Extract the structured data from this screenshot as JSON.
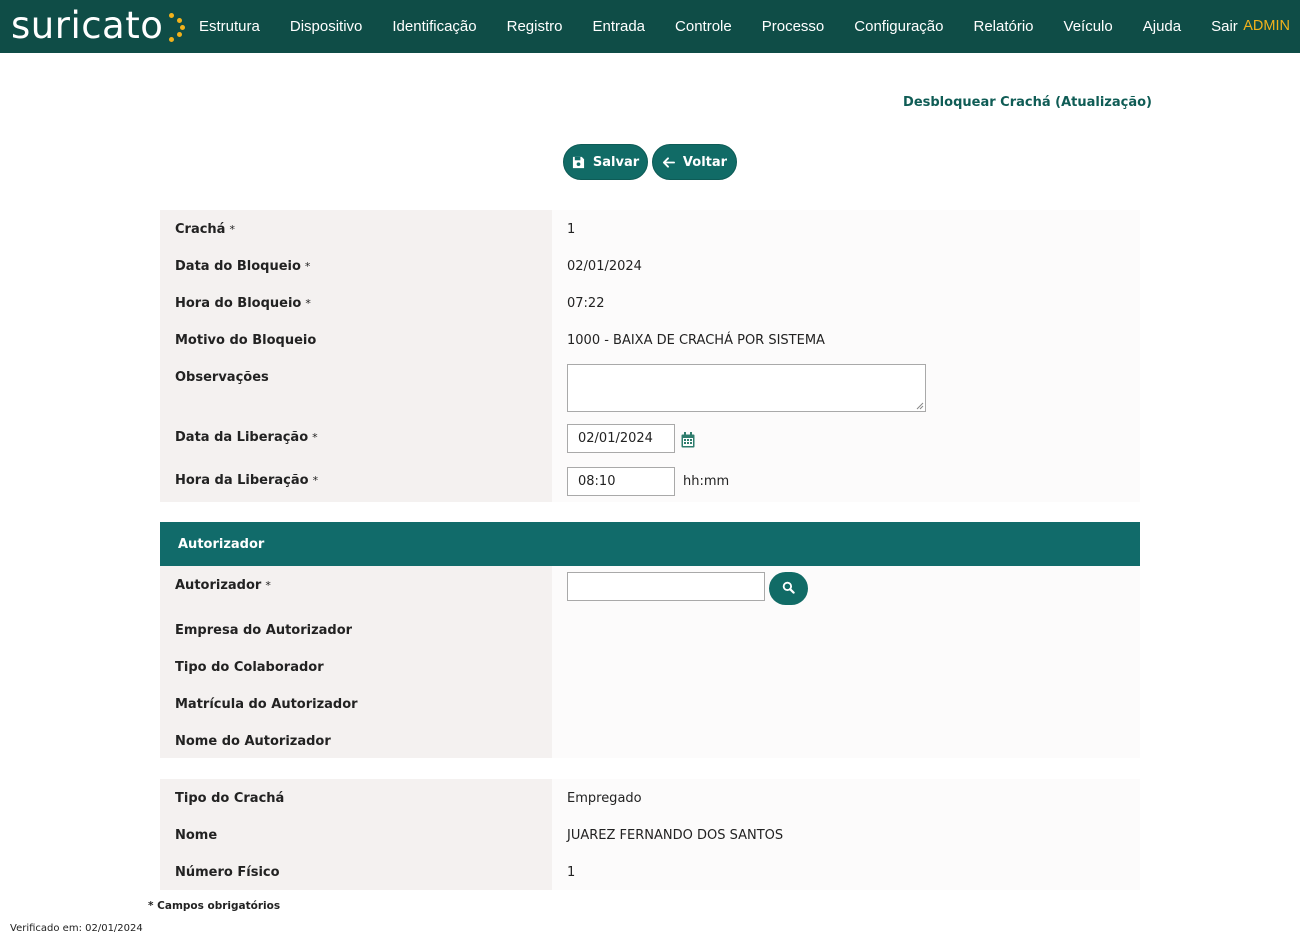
{
  "app": {
    "logo_text": "suricato",
    "brand_colors": {
      "primary": "#0f4d47",
      "accent": "#f3b21b",
      "button": "#116b66"
    }
  },
  "nav": {
    "items": [
      {
        "label": "Estrutura"
      },
      {
        "label": "Dispositivo"
      },
      {
        "label": "Identificação"
      },
      {
        "label": "Registro"
      },
      {
        "label": "Entrada"
      },
      {
        "label": "Controle"
      },
      {
        "label": "Processo"
      },
      {
        "label": "Configuração"
      },
      {
        "label": "Relatório"
      },
      {
        "label": "Veículo"
      },
      {
        "label": "Ajuda"
      },
      {
        "label": "Sair"
      }
    ],
    "user": "ADMIN"
  },
  "page": {
    "title": "Desbloquear Crachá (Atualização)"
  },
  "actions": {
    "save_label": "Salvar",
    "save_icon": "floppy-disk-icon",
    "back_label": "Voltar",
    "back_icon": "arrow-left-icon"
  },
  "block_info": {
    "cracha": {
      "label": "Crachá",
      "required": "*",
      "value": "1"
    },
    "data_bloqueio": {
      "label": "Data do Bloqueio",
      "required": "*",
      "value": "02/01/2024"
    },
    "hora_bloqueio": {
      "label": "Hora do Bloqueio",
      "required": "*",
      "value": "07:22"
    },
    "motivo_bloqueio": {
      "label": "Motivo do Bloqueio",
      "value": "1000 - BAIXA DE CRACHÁ POR SISTEMA"
    },
    "observacoes": {
      "label": "Observações",
      "value": ""
    },
    "data_liberacao": {
      "label": "Data da Liberação",
      "required": "*",
      "value": "02/01/2024",
      "icon": "calendar-icon"
    },
    "hora_liberacao": {
      "label": "Hora da Liberação",
      "required": "*",
      "value": "08:10",
      "hint": "hh:mm"
    }
  },
  "autorizador": {
    "section_title": "Autorizador",
    "autorizador": {
      "label": "Autorizador",
      "required": "*",
      "value": "",
      "search_icon": "search-icon"
    },
    "empresa": {
      "label": "Empresa do Autorizador"
    },
    "tipo_colaborador": {
      "label": "Tipo do Colaborador"
    },
    "matricula": {
      "label": "Matrícula do Autorizador"
    },
    "nome": {
      "label": "Nome do Autorizador"
    }
  },
  "badge_info": {
    "tipo_cracha": {
      "label": "Tipo do Crachá",
      "value": "Empregado"
    },
    "nome": {
      "label": "Nome",
      "value": "JUAREZ FERNANDO DOS SANTOS"
    },
    "numero_fisico": {
      "label": "Número Físico",
      "value": "1"
    }
  },
  "footer": {
    "required_note": "* Campos obrigatórios",
    "verified": "Verificado em: 02/01/2024"
  }
}
